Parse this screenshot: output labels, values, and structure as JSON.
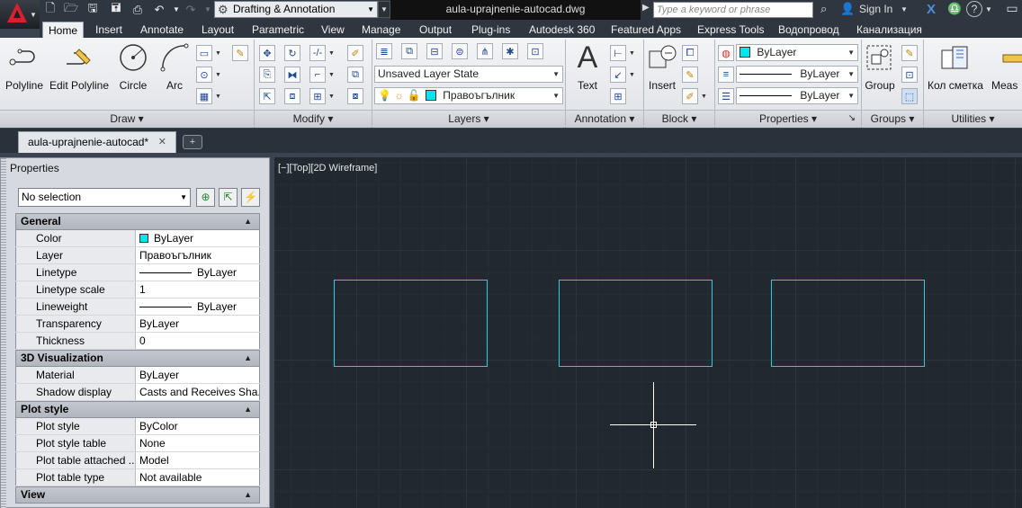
{
  "titlebar": {
    "workspace": "Drafting & Annotation",
    "document_title": "aula-uprajnenie-autocad.dwg",
    "search_placeholder": "Type a keyword or phrase",
    "sign_in": "Sign In"
  },
  "ribbon_tabs": [
    "Home",
    "Insert",
    "Annotate",
    "Layout",
    "Parametric",
    "View",
    "Manage",
    "Output",
    "Plug-ins",
    "Autodesk 360",
    "Featured Apps",
    "Express Tools",
    "Водопровод",
    "Канализация"
  ],
  "ribbon": {
    "draw": {
      "title": "Draw",
      "polyline": "Polyline",
      "edit_polyline": "Edit Polyline",
      "circle": "Circle",
      "arc": "Arc"
    },
    "modify": {
      "title": "Modify"
    },
    "layers": {
      "title": "Layers",
      "layer_state": "Unsaved Layer State",
      "current_layer": "Правоъгълник"
    },
    "annotation": {
      "title": "Annotation",
      "text": "Text"
    },
    "block": {
      "title": "Block",
      "insert": "Insert"
    },
    "properties": {
      "title": "Properties",
      "color": "ByLayer",
      "linetype": "ByLayer",
      "lineweight": "ByLayer"
    },
    "groups": {
      "title": "Groups",
      "group": "Group"
    },
    "utilities": {
      "title": "Utilities",
      "kol_smetka": "Кол сметка",
      "measure": "Meas"
    }
  },
  "doc_tab": {
    "label": "aula-uprajnenie-autocad*"
  },
  "properties_palette": {
    "title": "Properties",
    "selection": "No selection",
    "sections": [
      {
        "title": "General",
        "rows": [
          {
            "key": "Color",
            "value": "ByLayer"
          },
          {
            "key": "Layer",
            "value": "Правоъгълник"
          },
          {
            "key": "Linetype",
            "value": "ByLayer"
          },
          {
            "key": "Linetype scale",
            "value": "1"
          },
          {
            "key": "Lineweight",
            "value": "ByLayer"
          },
          {
            "key": "Transparency",
            "value": "ByLayer"
          },
          {
            "key": "Thickness",
            "value": "0"
          }
        ]
      },
      {
        "title": "3D Visualization",
        "rows": [
          {
            "key": "Material",
            "value": "ByLayer"
          },
          {
            "key": "Shadow display",
            "value": "Casts and Receives Sha..."
          }
        ]
      },
      {
        "title": "Plot style",
        "rows": [
          {
            "key": "Plot style",
            "value": "ByColor"
          },
          {
            "key": "Plot style table",
            "value": "None"
          },
          {
            "key": "Plot table attached ...",
            "value": "Model"
          },
          {
            "key": "Plot table type",
            "value": "Not available"
          }
        ]
      },
      {
        "title": "View",
        "rows": []
      }
    ]
  },
  "canvas": {
    "viewport_label": "[−][Top][2D Wireframe]",
    "line_color": "#19d3de"
  }
}
